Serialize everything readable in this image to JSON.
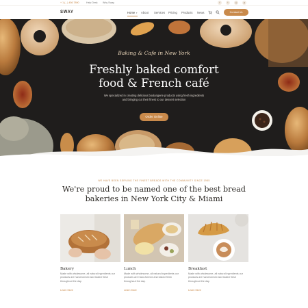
{
  "topbar": {
    "phone": "+ 1 (...) 456 7890",
    "links": [
      "Help Desk",
      "Why Sway"
    ],
    "social_icons": [
      "facebook-icon",
      "twitter-icon",
      "instagram-icon",
      "pinterest-icon"
    ]
  },
  "nav": {
    "logo": "SWAY",
    "items": [
      "Home",
      "About",
      "Services",
      "Pricing",
      "Products",
      "News"
    ],
    "cart_icon": "cart-icon",
    "search_icon": "search-icon",
    "contact_label": "Contact Us",
    "accent": "#c98a4b"
  },
  "hero": {
    "script": "Baking & Cafe in New York",
    "title_line1": "Freshly baked comfort",
    "title_line2": "food & French café",
    "subtitle_line1": "We specialized in creating delicious boulangerie products using fresh ingredients",
    "subtitle_line2": "and bringing out their finest to our dessert selection",
    "button": "Order Online",
    "background": "#1f1d1c"
  },
  "intro": {
    "eyebrow": "WE HAVE BEEN SERVING THE FINEST BREADS WITH THE COMMUNITY SINCE 1985",
    "heading_line1": "We're proud to be named one of the best bread",
    "heading_line2": "bakeries in New York City & Miami"
  },
  "cards": [
    {
      "title": "Bakery",
      "desc_lines": [
        "Made with wholesome, all natural ingredients our",
        "products are hand-formed and baked fresh",
        "throughout the day."
      ],
      "link": "Learn More"
    },
    {
      "title": "Lunch",
      "desc_lines": [
        "Made with wholesome, all natural ingredients our",
        "products are hand-formed and baked fresh",
        "throughout the day."
      ],
      "link": "Learn More"
    },
    {
      "title": "Breakfast",
      "desc_lines": [
        "Made with wholesome, all natural ingredients our",
        "products are hand-formed and baked fresh",
        "throughout the day."
      ],
      "link": "Learn More"
    }
  ]
}
